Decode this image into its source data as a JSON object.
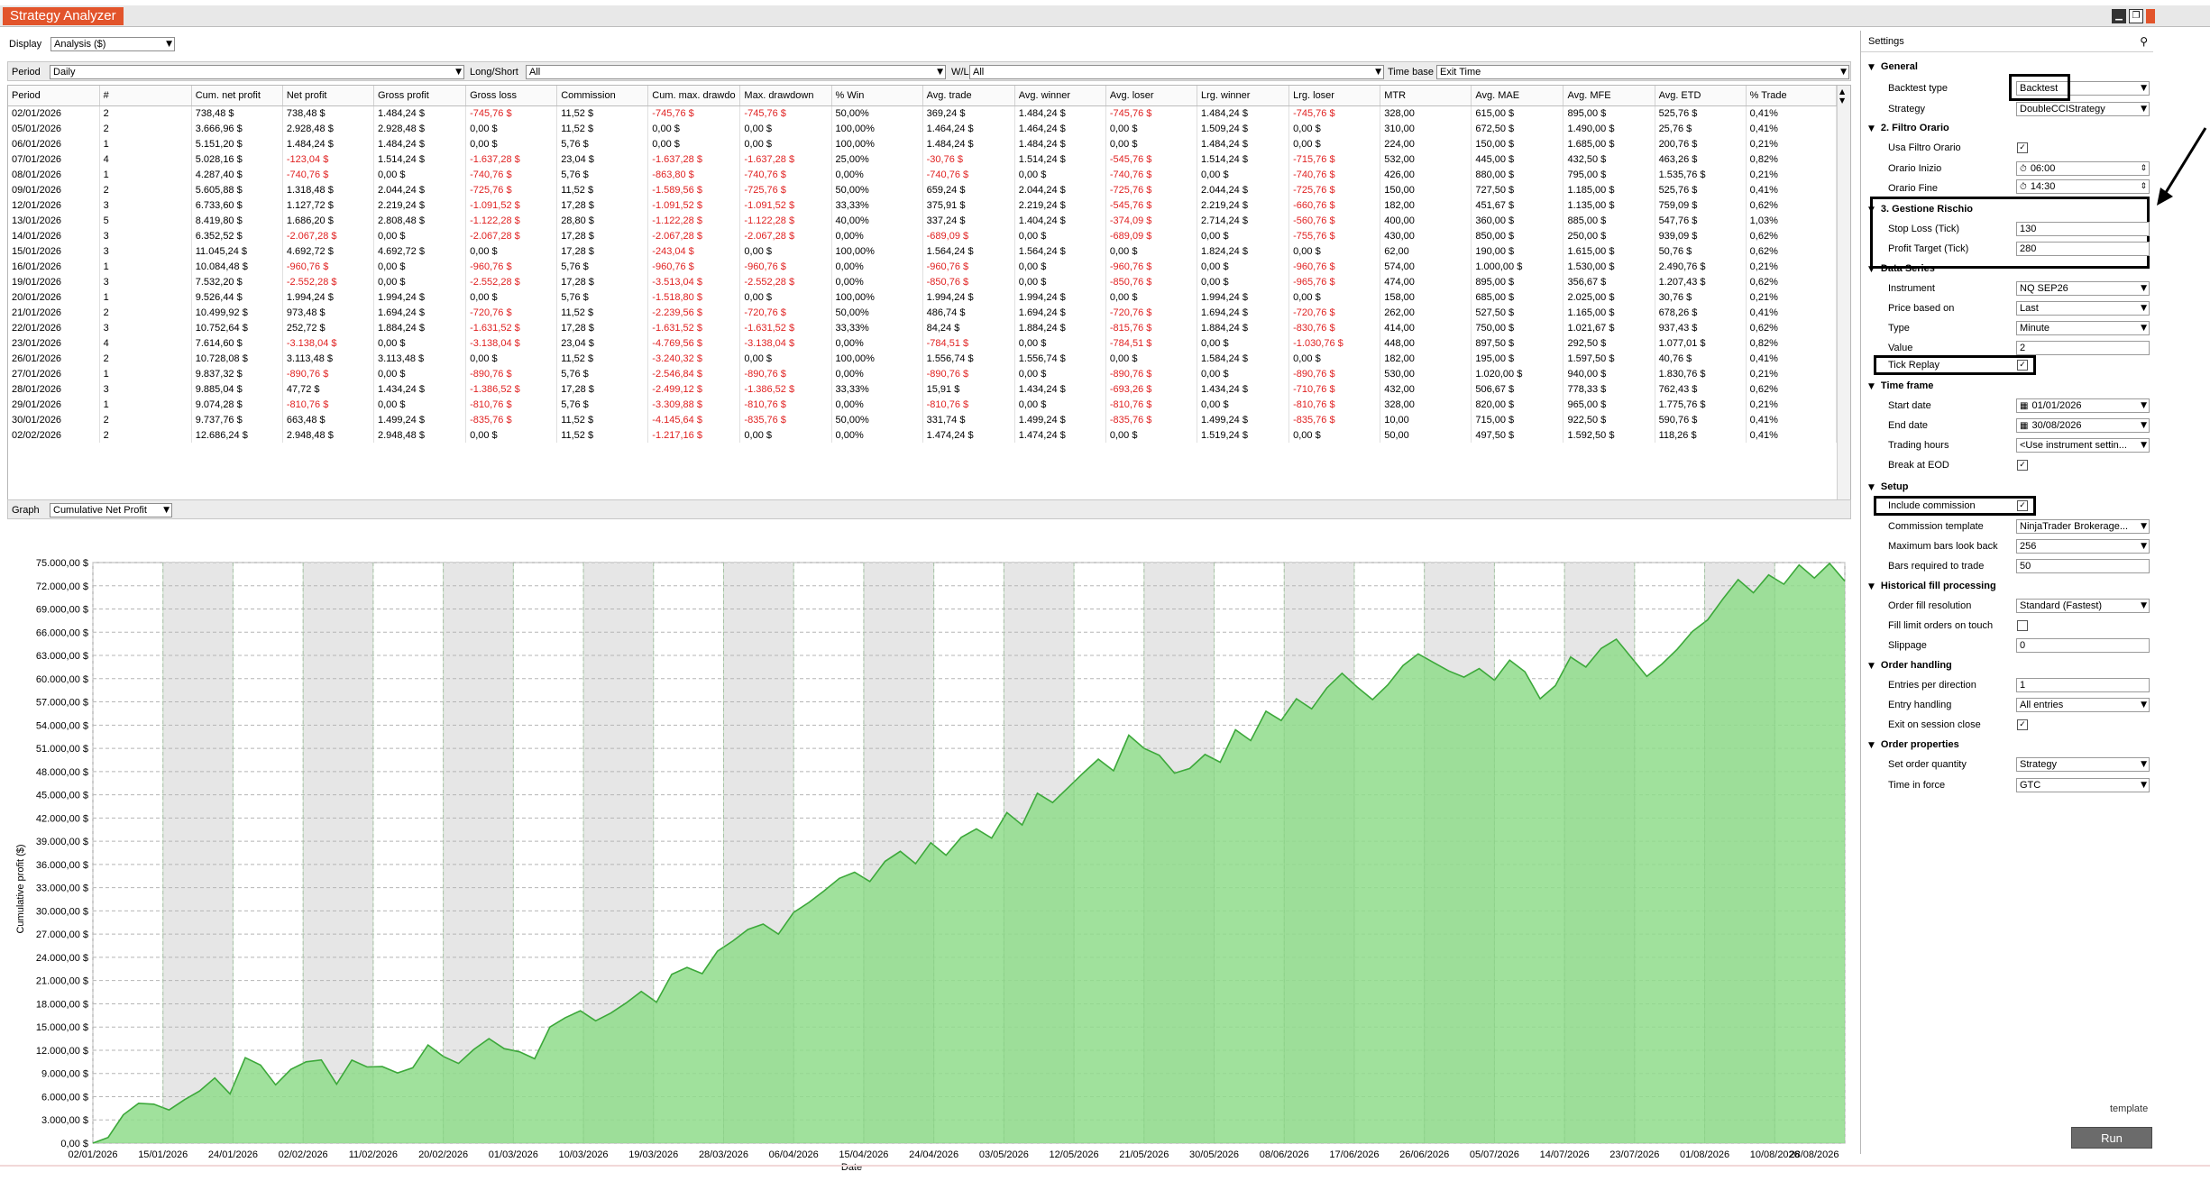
{
  "window": {
    "title": "Strategy Analyzer",
    "controls": {
      "minimize_icon": "minimize-icon",
      "restore_icon": "restore-icon",
      "close_icon": "close-icon"
    }
  },
  "display": {
    "label": "Display",
    "value": "Analysis ($)"
  },
  "filters": {
    "period": {
      "label": "Period",
      "value": "Daily"
    },
    "long_short": {
      "label": "Long/Short",
      "value": "All"
    },
    "wl": {
      "label": "W/L",
      "value": "All"
    },
    "time_base": {
      "label": "Time base",
      "value": "Exit Time"
    }
  },
  "table": {
    "columns": [
      "Period",
      "#",
      "Cum. net profit",
      "Net profit",
      "Gross profit",
      "Gross loss",
      "Commission",
      "Cum. max. drawdo",
      "Max. drawdown",
      "% Win",
      "Avg. trade",
      "Avg. winner",
      "Avg. loser",
      "Lrg. winner",
      "Lrg. loser",
      "MTR",
      "Avg. MAE",
      "Avg. MFE",
      "Avg. ETD",
      "% Trade"
    ],
    "negative_color": "#e02222",
    "rows": [
      [
        "02/01/2026",
        "2",
        "738,48 $",
        "738,48 $",
        "1.484,24 $",
        "-745,76 $",
        "11,52 $",
        "-745,76 $",
        "-745,76 $",
        "50,00%",
        "369,24 $",
        "1.484,24 $",
        "-745,76 $",
        "1.484,24 $",
        "-745,76 $",
        "328,00",
        "615,00 $",
        "895,00 $",
        "525,76 $",
        "0,41%"
      ],
      [
        "05/01/2026",
        "2",
        "3.666,96 $",
        "2.928,48 $",
        "2.928,48 $",
        "0,00 $",
        "11,52 $",
        "0,00 $",
        "0,00 $",
        "100,00%",
        "1.464,24 $",
        "1.464,24 $",
        "0,00 $",
        "1.509,24 $",
        "0,00 $",
        "310,00",
        "672,50 $",
        "1.490,00 $",
        "25,76 $",
        "0,41%"
      ],
      [
        "06/01/2026",
        "1",
        "5.151,20 $",
        "1.484,24 $",
        "1.484,24 $",
        "0,00 $",
        "5,76 $",
        "0,00 $",
        "0,00 $",
        "100,00%",
        "1.484,24 $",
        "1.484,24 $",
        "0,00 $",
        "1.484,24 $",
        "0,00 $",
        "224,00",
        "150,00 $",
        "1.685,00 $",
        "200,76 $",
        "0,21%"
      ],
      [
        "07/01/2026",
        "4",
        "5.028,16 $",
        "-123,04 $",
        "1.514,24 $",
        "-1.637,28 $",
        "23,04 $",
        "-1.637,28 $",
        "-1.637,28 $",
        "25,00%",
        "-30,76 $",
        "1.514,24 $",
        "-545,76 $",
        "1.514,24 $",
        "-715,76 $",
        "532,00",
        "445,00 $",
        "432,50 $",
        "463,26 $",
        "0,82%"
      ],
      [
        "08/01/2026",
        "1",
        "4.287,40 $",
        "-740,76 $",
        "0,00 $",
        "-740,76 $",
        "5,76 $",
        "-863,80 $",
        "-740,76 $",
        "0,00%",
        "-740,76 $",
        "0,00 $",
        "-740,76 $",
        "0,00 $",
        "-740,76 $",
        "426,00",
        "880,00 $",
        "795,00 $",
        "1.535,76 $",
        "0,21%"
      ],
      [
        "09/01/2026",
        "2",
        "5.605,88 $",
        "1.318,48 $",
        "2.044,24 $",
        "-725,76 $",
        "11,52 $",
        "-1.589,56 $",
        "-725,76 $",
        "50,00%",
        "659,24 $",
        "2.044,24 $",
        "-725,76 $",
        "2.044,24 $",
        "-725,76 $",
        "150,00",
        "727,50 $",
        "1.185,00 $",
        "525,76 $",
        "0,41%"
      ],
      [
        "12/01/2026",
        "3",
        "6.733,60 $",
        "1.127,72 $",
        "2.219,24 $",
        "-1.091,52 $",
        "17,28 $",
        "-1.091,52 $",
        "-1.091,52 $",
        "33,33%",
        "375,91 $",
        "2.219,24 $",
        "-545,76 $",
        "2.219,24 $",
        "-660,76 $",
        "182,00",
        "451,67 $",
        "1.135,00 $",
        "759,09 $",
        "0,62%"
      ],
      [
        "13/01/2026",
        "5",
        "8.419,80 $",
        "1.686,20 $",
        "2.808,48 $",
        "-1.122,28 $",
        "28,80 $",
        "-1.122,28 $",
        "-1.122,28 $",
        "40,00%",
        "337,24 $",
        "1.404,24 $",
        "-374,09 $",
        "2.714,24 $",
        "-560,76 $",
        "400,00",
        "360,00 $",
        "885,00 $",
        "547,76 $",
        "1,03%"
      ],
      [
        "14/01/2026",
        "3",
        "6.352,52 $",
        "-2.067,28 $",
        "0,00 $",
        "-2.067,28 $",
        "17,28 $",
        "-2.067,28 $",
        "-2.067,28 $",
        "0,00%",
        "-689,09 $",
        "0,00 $",
        "-689,09 $",
        "0,00 $",
        "-755,76 $",
        "430,00",
        "850,00 $",
        "250,00 $",
        "939,09 $",
        "0,62%"
      ],
      [
        "15/01/2026",
        "3",
        "11.045,24 $",
        "4.692,72 $",
        "4.692,72 $",
        "0,00 $",
        "17,28 $",
        "-243,04 $",
        "0,00 $",
        "100,00%",
        "1.564,24 $",
        "1.564,24 $",
        "0,00 $",
        "1.824,24 $",
        "0,00 $",
        "62,00",
        "190,00 $",
        "1.615,00 $",
        "50,76 $",
        "0,62%"
      ],
      [
        "16/01/2026",
        "1",
        "10.084,48 $",
        "-960,76 $",
        "0,00 $",
        "-960,76 $",
        "5,76 $",
        "-960,76 $",
        "-960,76 $",
        "0,00%",
        "-960,76 $",
        "0,00 $",
        "-960,76 $",
        "0,00 $",
        "-960,76 $",
        "574,00",
        "1.000,00 $",
        "1.530,00 $",
        "2.490,76 $",
        "0,21%"
      ],
      [
        "19/01/2026",
        "3",
        "7.532,20 $",
        "-2.552,28 $",
        "0,00 $",
        "-2.552,28 $",
        "17,28 $",
        "-3.513,04 $",
        "-2.552,28 $",
        "0,00%",
        "-850,76 $",
        "0,00 $",
        "-850,76 $",
        "0,00 $",
        "-965,76 $",
        "474,00",
        "895,00 $",
        "356,67 $",
        "1.207,43 $",
        "0,62%"
      ],
      [
        "20/01/2026",
        "1",
        "9.526,44 $",
        "1.994,24 $",
        "1.994,24 $",
        "0,00 $",
        "5,76 $",
        "-1.518,80 $",
        "0,00 $",
        "100,00%",
        "1.994,24 $",
        "1.994,24 $",
        "0,00 $",
        "1.994,24 $",
        "0,00 $",
        "158,00",
        "685,00 $",
        "2.025,00 $",
        "30,76 $",
        "0,21%"
      ],
      [
        "21/01/2026",
        "2",
        "10.499,92 $",
        "973,48 $",
        "1.694,24 $",
        "-720,76 $",
        "11,52 $",
        "-2.239,56 $",
        "-720,76 $",
        "50,00%",
        "486,74 $",
        "1.694,24 $",
        "-720,76 $",
        "1.694,24 $",
        "-720,76 $",
        "262,00",
        "527,50 $",
        "1.165,00 $",
        "678,26 $",
        "0,41%"
      ],
      [
        "22/01/2026",
        "3",
        "10.752,64 $",
        "252,72 $",
        "1.884,24 $",
        "-1.631,52 $",
        "17,28 $",
        "-1.631,52 $",
        "-1.631,52 $",
        "33,33%",
        "84,24 $",
        "1.884,24 $",
        "-815,76 $",
        "1.884,24 $",
        "-830,76 $",
        "414,00",
        "750,00 $",
        "1.021,67 $",
        "937,43 $",
        "0,62%"
      ],
      [
        "23/01/2026",
        "4",
        "7.614,60 $",
        "-3.138,04 $",
        "0,00 $",
        "-3.138,04 $",
        "23,04 $",
        "-4.769,56 $",
        "-3.138,04 $",
        "0,00%",
        "-784,51 $",
        "0,00 $",
        "-784,51 $",
        "0,00 $",
        "-1.030,76 $",
        "448,00",
        "897,50 $",
        "292,50 $",
        "1.077,01 $",
        "0,82%"
      ],
      [
        "26/01/2026",
        "2",
        "10.728,08 $",
        "3.113,48 $",
        "3.113,48 $",
        "0,00 $",
        "11,52 $",
        "-3.240,32 $",
        "0,00 $",
        "100,00%",
        "1.556,74 $",
        "1.556,74 $",
        "0,00 $",
        "1.584,24 $",
        "0,00 $",
        "182,00",
        "195,00 $",
        "1.597,50 $",
        "40,76 $",
        "0,41%"
      ],
      [
        "27/01/2026",
        "1",
        "9.837,32 $",
        "-890,76 $",
        "0,00 $",
        "-890,76 $",
        "5,76 $",
        "-2.546,84 $",
        "-890,76 $",
        "0,00%",
        "-890,76 $",
        "0,00 $",
        "-890,76 $",
        "0,00 $",
        "-890,76 $",
        "530,00",
        "1.020,00 $",
        "940,00 $",
        "1.830,76 $",
        "0,21%"
      ],
      [
        "28/01/2026",
        "3",
        "9.885,04 $",
        "47,72 $",
        "1.434,24 $",
        "-1.386,52 $",
        "17,28 $",
        "-2.499,12 $",
        "-1.386,52 $",
        "33,33%",
        "15,91 $",
        "1.434,24 $",
        "-693,26 $",
        "1.434,24 $",
        "-710,76 $",
        "432,00",
        "506,67 $",
        "778,33 $",
        "762,43 $",
        "0,62%"
      ],
      [
        "29/01/2026",
        "1",
        "9.074,28 $",
        "-810,76 $",
        "0,00 $",
        "-810,76 $",
        "5,76 $",
        "-3.309,88 $",
        "-810,76 $",
        "0,00%",
        "-810,76 $",
        "0,00 $",
        "-810,76 $",
        "0,00 $",
        "-810,76 $",
        "328,00",
        "820,00 $",
        "965,00 $",
        "1.775,76 $",
        "0,21%"
      ],
      [
        "30/01/2026",
        "2",
        "9.737,76 $",
        "663,48 $",
        "1.499,24 $",
        "-835,76 $",
        "11,52 $",
        "-4.145,64 $",
        "-835,76 $",
        "50,00%",
        "331,74 $",
        "1.499,24 $",
        "-835,76 $",
        "1.499,24 $",
        "-835,76 $",
        "10,00",
        "715,00 $",
        "922,50 $",
        "590,76 $",
        "0,41%"
      ],
      [
        "02/02/2026",
        "2",
        "12.686,24 $",
        "2.948,48 $",
        "2.948,48 $",
        "0,00 $",
        "11,52 $",
        "-1.217,16 $",
        "0,00 $",
        "0,00%",
        "1.474,24 $",
        "1.474,24 $",
        "0,00 $",
        "1.519,24 $",
        "0,00 $",
        "50,00",
        "497,50 $",
        "1.592,50 $",
        "118,26 $",
        "0,41%"
      ]
    ]
  },
  "graph": {
    "label": "Graph",
    "value": "Cumulative Net Profit"
  },
  "chart_data": {
    "type": "area",
    "xlabel": "Date",
    "ylabel": "Cumulative profit ($)",
    "ylim": [
      0,
      75000
    ],
    "y_ticks": [
      "0,00 $",
      "3.000,00 $",
      "6.000,00 $",
      "9.000,00 $",
      "12.000,00 $",
      "15.000,00 $",
      "18.000,00 $",
      "21.000,00 $",
      "24.000,00 $",
      "27.000,00 $",
      "30.000,00 $",
      "33.000,00 $",
      "36.000,00 $",
      "39.000,00 $",
      "42.000,00 $",
      "45.000,00 $",
      "48.000,00 $",
      "51.000,00 $",
      "54.000,00 $",
      "57.000,00 $",
      "60.000,00 $",
      "63.000,00 $",
      "66.000,00 $",
      "69.000,00 $",
      "72.000,00 $",
      "75.000,00 $"
    ],
    "x_ticks": [
      "02/01/2026",
      "15/01/2026",
      "24/01/2026",
      "02/02/2026",
      "11/02/2026",
      "20/02/2026",
      "01/03/2026",
      "10/03/2026",
      "19/03/2026",
      "28/03/2026",
      "06/04/2026",
      "15/04/2026",
      "24/04/2026",
      "03/05/2026",
      "12/05/2026",
      "21/05/2026",
      "30/05/2026",
      "08/06/2026",
      "17/06/2026",
      "26/06/2026",
      "05/07/2026",
      "14/07/2026",
      "23/07/2026",
      "01/08/2026",
      "10/08/2026",
      "28/08/2026"
    ],
    "fill_color": "#8fdc8b",
    "line_color": "#3ca83a",
    "values": [
      0,
      738,
      3667,
      5151,
      5028,
      4287,
      5606,
      6734,
      8420,
      6353,
      11045,
      10084,
      7532,
      9526,
      10500,
      10753,
      7615,
      10728,
      9837,
      9885,
      9074,
      9738,
      12686,
      11200,
      10300,
      12100,
      13500,
      12200,
      11800,
      10900,
      15000,
      16200,
      17100,
      15800,
      16800,
      18100,
      19600,
      18200,
      21800,
      22700,
      21900,
      24800,
      26100,
      27600,
      28300,
      27000,
      29800,
      31100,
      32600,
      34200,
      35000,
      33800,
      36400,
      37700,
      36100,
      38800,
      37200,
      39500,
      40600,
      39400,
      42700,
      41100,
      45200,
      44000,
      45900,
      47800,
      49600,
      48100,
      52700,
      51000,
      50100,
      47800,
      48400,
      50200,
      49200,
      53400,
      52000,
      55800,
      54600,
      57400,
      56100,
      58800,
      60700,
      58900,
      57300,
      59200,
      61700,
      63200,
      62100,
      61000,
      60200,
      61300,
      59800,
      62400,
      60900,
      57400,
      59100,
      62800,
      61500,
      63900,
      65100,
      62700,
      60300,
      61900,
      63800,
      66100,
      67600,
      70300,
      72800,
      71100,
      73400,
      72200,
      74700,
      73000,
      74900,
      72600
    ]
  },
  "settings": {
    "title": "Settings",
    "pin_icon": "pin-icon",
    "sections": {
      "general": {
        "title": "General",
        "backtest_type": {
          "label": "Backtest type",
          "value": "Backtest"
        },
        "strategy": {
          "label": "Strategy",
          "value": "DoubleCCIStrategy"
        }
      },
      "filtro": {
        "title": "2. Filtro Orario",
        "usa": {
          "label": "Usa Filtro Orario"
        },
        "inizio": {
          "label": "Orario Inizio",
          "value": "06:00"
        },
        "fine": {
          "label": "Orario Fine",
          "value": "14:30"
        }
      },
      "rischio": {
        "title": "3. Gestione Rischio",
        "sl": {
          "label": "Stop Loss (Tick)",
          "value": "130"
        },
        "pt": {
          "label": "Profit Target (Tick)",
          "value": "280"
        }
      },
      "data_series": {
        "title": "Data Series",
        "instrument": {
          "label": "Instrument",
          "value": "NQ SEP26"
        },
        "price": {
          "label": "Price based on",
          "value": "Last"
        },
        "type": {
          "label": "Type",
          "value": "Minute"
        },
        "value": {
          "label": "Value",
          "value": "2"
        },
        "tick_replay": {
          "label": "Tick Replay"
        }
      },
      "time_frame": {
        "title": "Time frame",
        "start": {
          "label": "Start date",
          "value": "01/01/2026"
        },
        "end": {
          "label": "End date",
          "value": "30/08/2026"
        },
        "trading_hours": {
          "label": "Trading hours",
          "value": "<Use instrument settin..."
        },
        "break_eod": {
          "label": "Break at EOD"
        }
      },
      "setup": {
        "title": "Setup",
        "include_commission": {
          "label": "Include commission"
        },
        "commission_template": {
          "label": "Commission template",
          "value": "NinjaTrader Brokerage..."
        },
        "max_bars": {
          "label": "Maximum bars look back",
          "value": "256"
        },
        "bars_required": {
          "label": "Bars required to trade",
          "value": "50"
        }
      },
      "historical": {
        "title": "Historical fill processing",
        "resolution": {
          "label": "Order fill resolution",
          "value": "Standard (Fastest)"
        },
        "fill_limit": {
          "label": "Fill limit orders on touch"
        },
        "slippage": {
          "label": "Slippage",
          "value": "0"
        }
      },
      "order_handling": {
        "title": "Order handling",
        "entries": {
          "label": "Entries per direction",
          "value": "1"
        },
        "entry_handling": {
          "label": "Entry handling",
          "value": "All entries"
        },
        "exit_close": {
          "label": "Exit on session close"
        }
      },
      "order_props": {
        "title": "Order properties",
        "quantity": {
          "label": "Set order quantity",
          "value": "Strategy"
        },
        "tif": {
          "label": "Time in force",
          "value": "GTC"
        }
      }
    },
    "template_label": "template",
    "run_label": "Run"
  }
}
